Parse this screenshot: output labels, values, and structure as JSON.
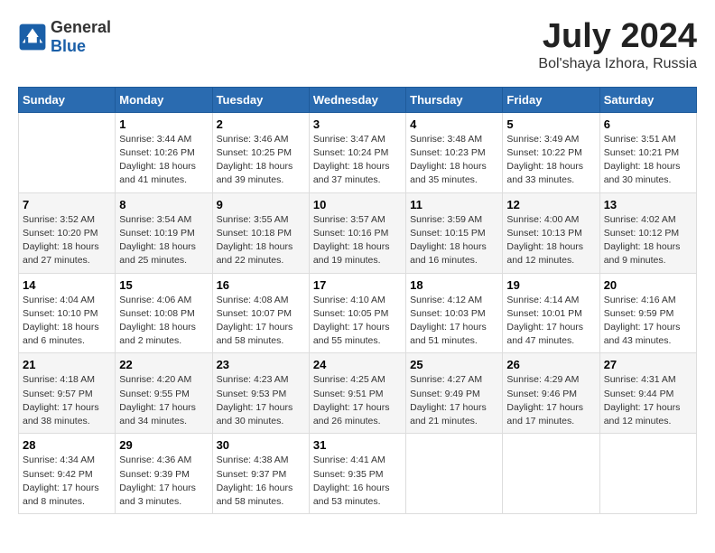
{
  "header": {
    "logo_general": "General",
    "logo_blue": "Blue",
    "month_year": "July 2024",
    "location": "Bol'shaya Izhora, Russia"
  },
  "days_of_week": [
    "Sunday",
    "Monday",
    "Tuesday",
    "Wednesday",
    "Thursday",
    "Friday",
    "Saturday"
  ],
  "weeks": [
    [
      {
        "day": "",
        "content": ""
      },
      {
        "day": "1",
        "content": "Sunrise: 3:44 AM\nSunset: 10:26 PM\nDaylight: 18 hours\nand 41 minutes."
      },
      {
        "day": "2",
        "content": "Sunrise: 3:46 AM\nSunset: 10:25 PM\nDaylight: 18 hours\nand 39 minutes."
      },
      {
        "day": "3",
        "content": "Sunrise: 3:47 AM\nSunset: 10:24 PM\nDaylight: 18 hours\nand 37 minutes."
      },
      {
        "day": "4",
        "content": "Sunrise: 3:48 AM\nSunset: 10:23 PM\nDaylight: 18 hours\nand 35 minutes."
      },
      {
        "day": "5",
        "content": "Sunrise: 3:49 AM\nSunset: 10:22 PM\nDaylight: 18 hours\nand 33 minutes."
      },
      {
        "day": "6",
        "content": "Sunrise: 3:51 AM\nSunset: 10:21 PM\nDaylight: 18 hours\nand 30 minutes."
      }
    ],
    [
      {
        "day": "7",
        "content": "Sunrise: 3:52 AM\nSunset: 10:20 PM\nDaylight: 18 hours\nand 27 minutes."
      },
      {
        "day": "8",
        "content": "Sunrise: 3:54 AM\nSunset: 10:19 PM\nDaylight: 18 hours\nand 25 minutes."
      },
      {
        "day": "9",
        "content": "Sunrise: 3:55 AM\nSunset: 10:18 PM\nDaylight: 18 hours\nand 22 minutes."
      },
      {
        "day": "10",
        "content": "Sunrise: 3:57 AM\nSunset: 10:16 PM\nDaylight: 18 hours\nand 19 minutes."
      },
      {
        "day": "11",
        "content": "Sunrise: 3:59 AM\nSunset: 10:15 PM\nDaylight: 18 hours\nand 16 minutes."
      },
      {
        "day": "12",
        "content": "Sunrise: 4:00 AM\nSunset: 10:13 PM\nDaylight: 18 hours\nand 12 minutes."
      },
      {
        "day": "13",
        "content": "Sunrise: 4:02 AM\nSunset: 10:12 PM\nDaylight: 18 hours\nand 9 minutes."
      }
    ],
    [
      {
        "day": "14",
        "content": "Sunrise: 4:04 AM\nSunset: 10:10 PM\nDaylight: 18 hours\nand 6 minutes."
      },
      {
        "day": "15",
        "content": "Sunrise: 4:06 AM\nSunset: 10:08 PM\nDaylight: 18 hours\nand 2 minutes."
      },
      {
        "day": "16",
        "content": "Sunrise: 4:08 AM\nSunset: 10:07 PM\nDaylight: 17 hours\nand 58 minutes."
      },
      {
        "day": "17",
        "content": "Sunrise: 4:10 AM\nSunset: 10:05 PM\nDaylight: 17 hours\nand 55 minutes."
      },
      {
        "day": "18",
        "content": "Sunrise: 4:12 AM\nSunset: 10:03 PM\nDaylight: 17 hours\nand 51 minutes."
      },
      {
        "day": "19",
        "content": "Sunrise: 4:14 AM\nSunset: 10:01 PM\nDaylight: 17 hours\nand 47 minutes."
      },
      {
        "day": "20",
        "content": "Sunrise: 4:16 AM\nSunset: 9:59 PM\nDaylight: 17 hours\nand 43 minutes."
      }
    ],
    [
      {
        "day": "21",
        "content": "Sunrise: 4:18 AM\nSunset: 9:57 PM\nDaylight: 17 hours\nand 38 minutes."
      },
      {
        "day": "22",
        "content": "Sunrise: 4:20 AM\nSunset: 9:55 PM\nDaylight: 17 hours\nand 34 minutes."
      },
      {
        "day": "23",
        "content": "Sunrise: 4:23 AM\nSunset: 9:53 PM\nDaylight: 17 hours\nand 30 minutes."
      },
      {
        "day": "24",
        "content": "Sunrise: 4:25 AM\nSunset: 9:51 PM\nDaylight: 17 hours\nand 26 minutes."
      },
      {
        "day": "25",
        "content": "Sunrise: 4:27 AM\nSunset: 9:49 PM\nDaylight: 17 hours\nand 21 minutes."
      },
      {
        "day": "26",
        "content": "Sunrise: 4:29 AM\nSunset: 9:46 PM\nDaylight: 17 hours\nand 17 minutes."
      },
      {
        "day": "27",
        "content": "Sunrise: 4:31 AM\nSunset: 9:44 PM\nDaylight: 17 hours\nand 12 minutes."
      }
    ],
    [
      {
        "day": "28",
        "content": "Sunrise: 4:34 AM\nSunset: 9:42 PM\nDaylight: 17 hours\nand 8 minutes."
      },
      {
        "day": "29",
        "content": "Sunrise: 4:36 AM\nSunset: 9:39 PM\nDaylight: 17 hours\nand 3 minutes."
      },
      {
        "day": "30",
        "content": "Sunrise: 4:38 AM\nSunset: 9:37 PM\nDaylight: 16 hours\nand 58 minutes."
      },
      {
        "day": "31",
        "content": "Sunrise: 4:41 AM\nSunset: 9:35 PM\nDaylight: 16 hours\nand 53 minutes."
      },
      {
        "day": "",
        "content": ""
      },
      {
        "day": "",
        "content": ""
      },
      {
        "day": "",
        "content": ""
      }
    ]
  ]
}
